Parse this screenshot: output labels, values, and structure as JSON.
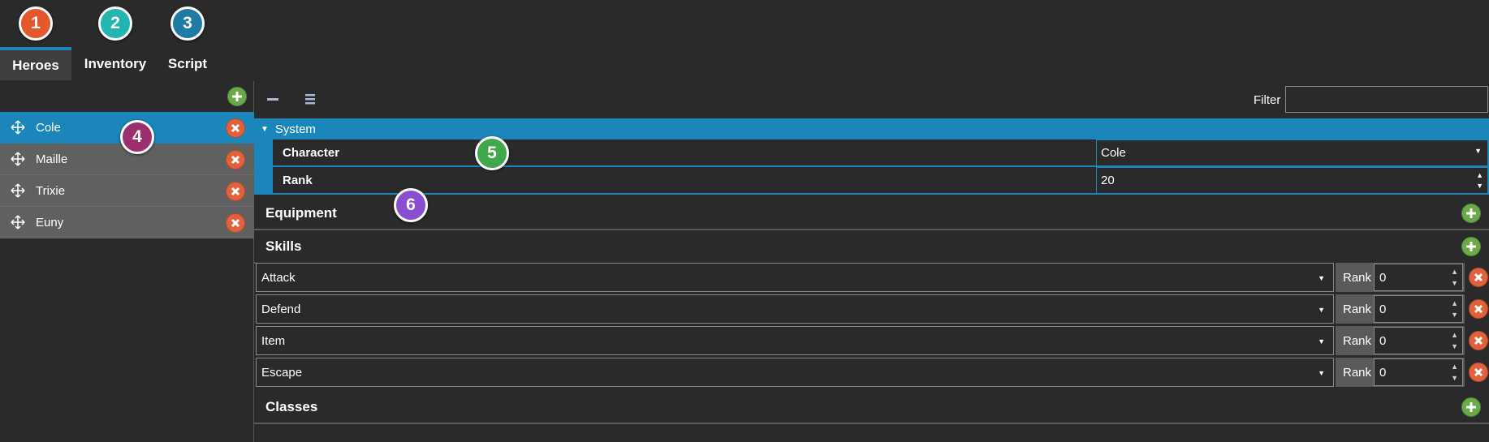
{
  "tabs": [
    {
      "number": "1",
      "label": "Heroes",
      "badge_color": "#e5582e",
      "active": true
    },
    {
      "number": "2",
      "label": "Inventory",
      "badge_color": "#23b5b0",
      "active": false
    },
    {
      "number": "3",
      "label": "Script",
      "badge_color": "#1f7aa5",
      "active": false
    }
  ],
  "heroes": [
    "Cole",
    "Maille",
    "Trixie",
    "Euny"
  ],
  "selected_hero": "Cole",
  "callouts": [
    {
      "number": "4",
      "color": "#9c2f6e"
    },
    {
      "number": "5",
      "color": "#3fa84a"
    },
    {
      "number": "6",
      "color": "#8a4fcf"
    }
  ],
  "toolbar": {
    "filter_label": "Filter",
    "filter_value": ""
  },
  "system": {
    "header": "System",
    "character_label": "Character",
    "character_value": "Cole",
    "rank_label": "Rank",
    "rank_value": "20"
  },
  "sections": {
    "equipment": "Equipment",
    "skills": "Skills",
    "classes": "Classes"
  },
  "skills": [
    {
      "name": "Attack",
      "rank_label": "Rank",
      "rank": "0"
    },
    {
      "name": "Defend",
      "rank_label": "Rank",
      "rank": "0"
    },
    {
      "name": "Item",
      "rank_label": "Rank",
      "rank": "0"
    },
    {
      "name": "Escape",
      "rank_label": "Rank",
      "rank": "0"
    }
  ],
  "colors": {
    "accent": "#1b86ba",
    "add": "#6aa84a",
    "delete": "#e0623d"
  },
  "icons": {
    "add": "plus-circle-icon",
    "delete": "x-circle-icon",
    "move": "move-arrows-icon",
    "collapse": "collapse-minus-icon",
    "expand": "expand-list-icon"
  }
}
